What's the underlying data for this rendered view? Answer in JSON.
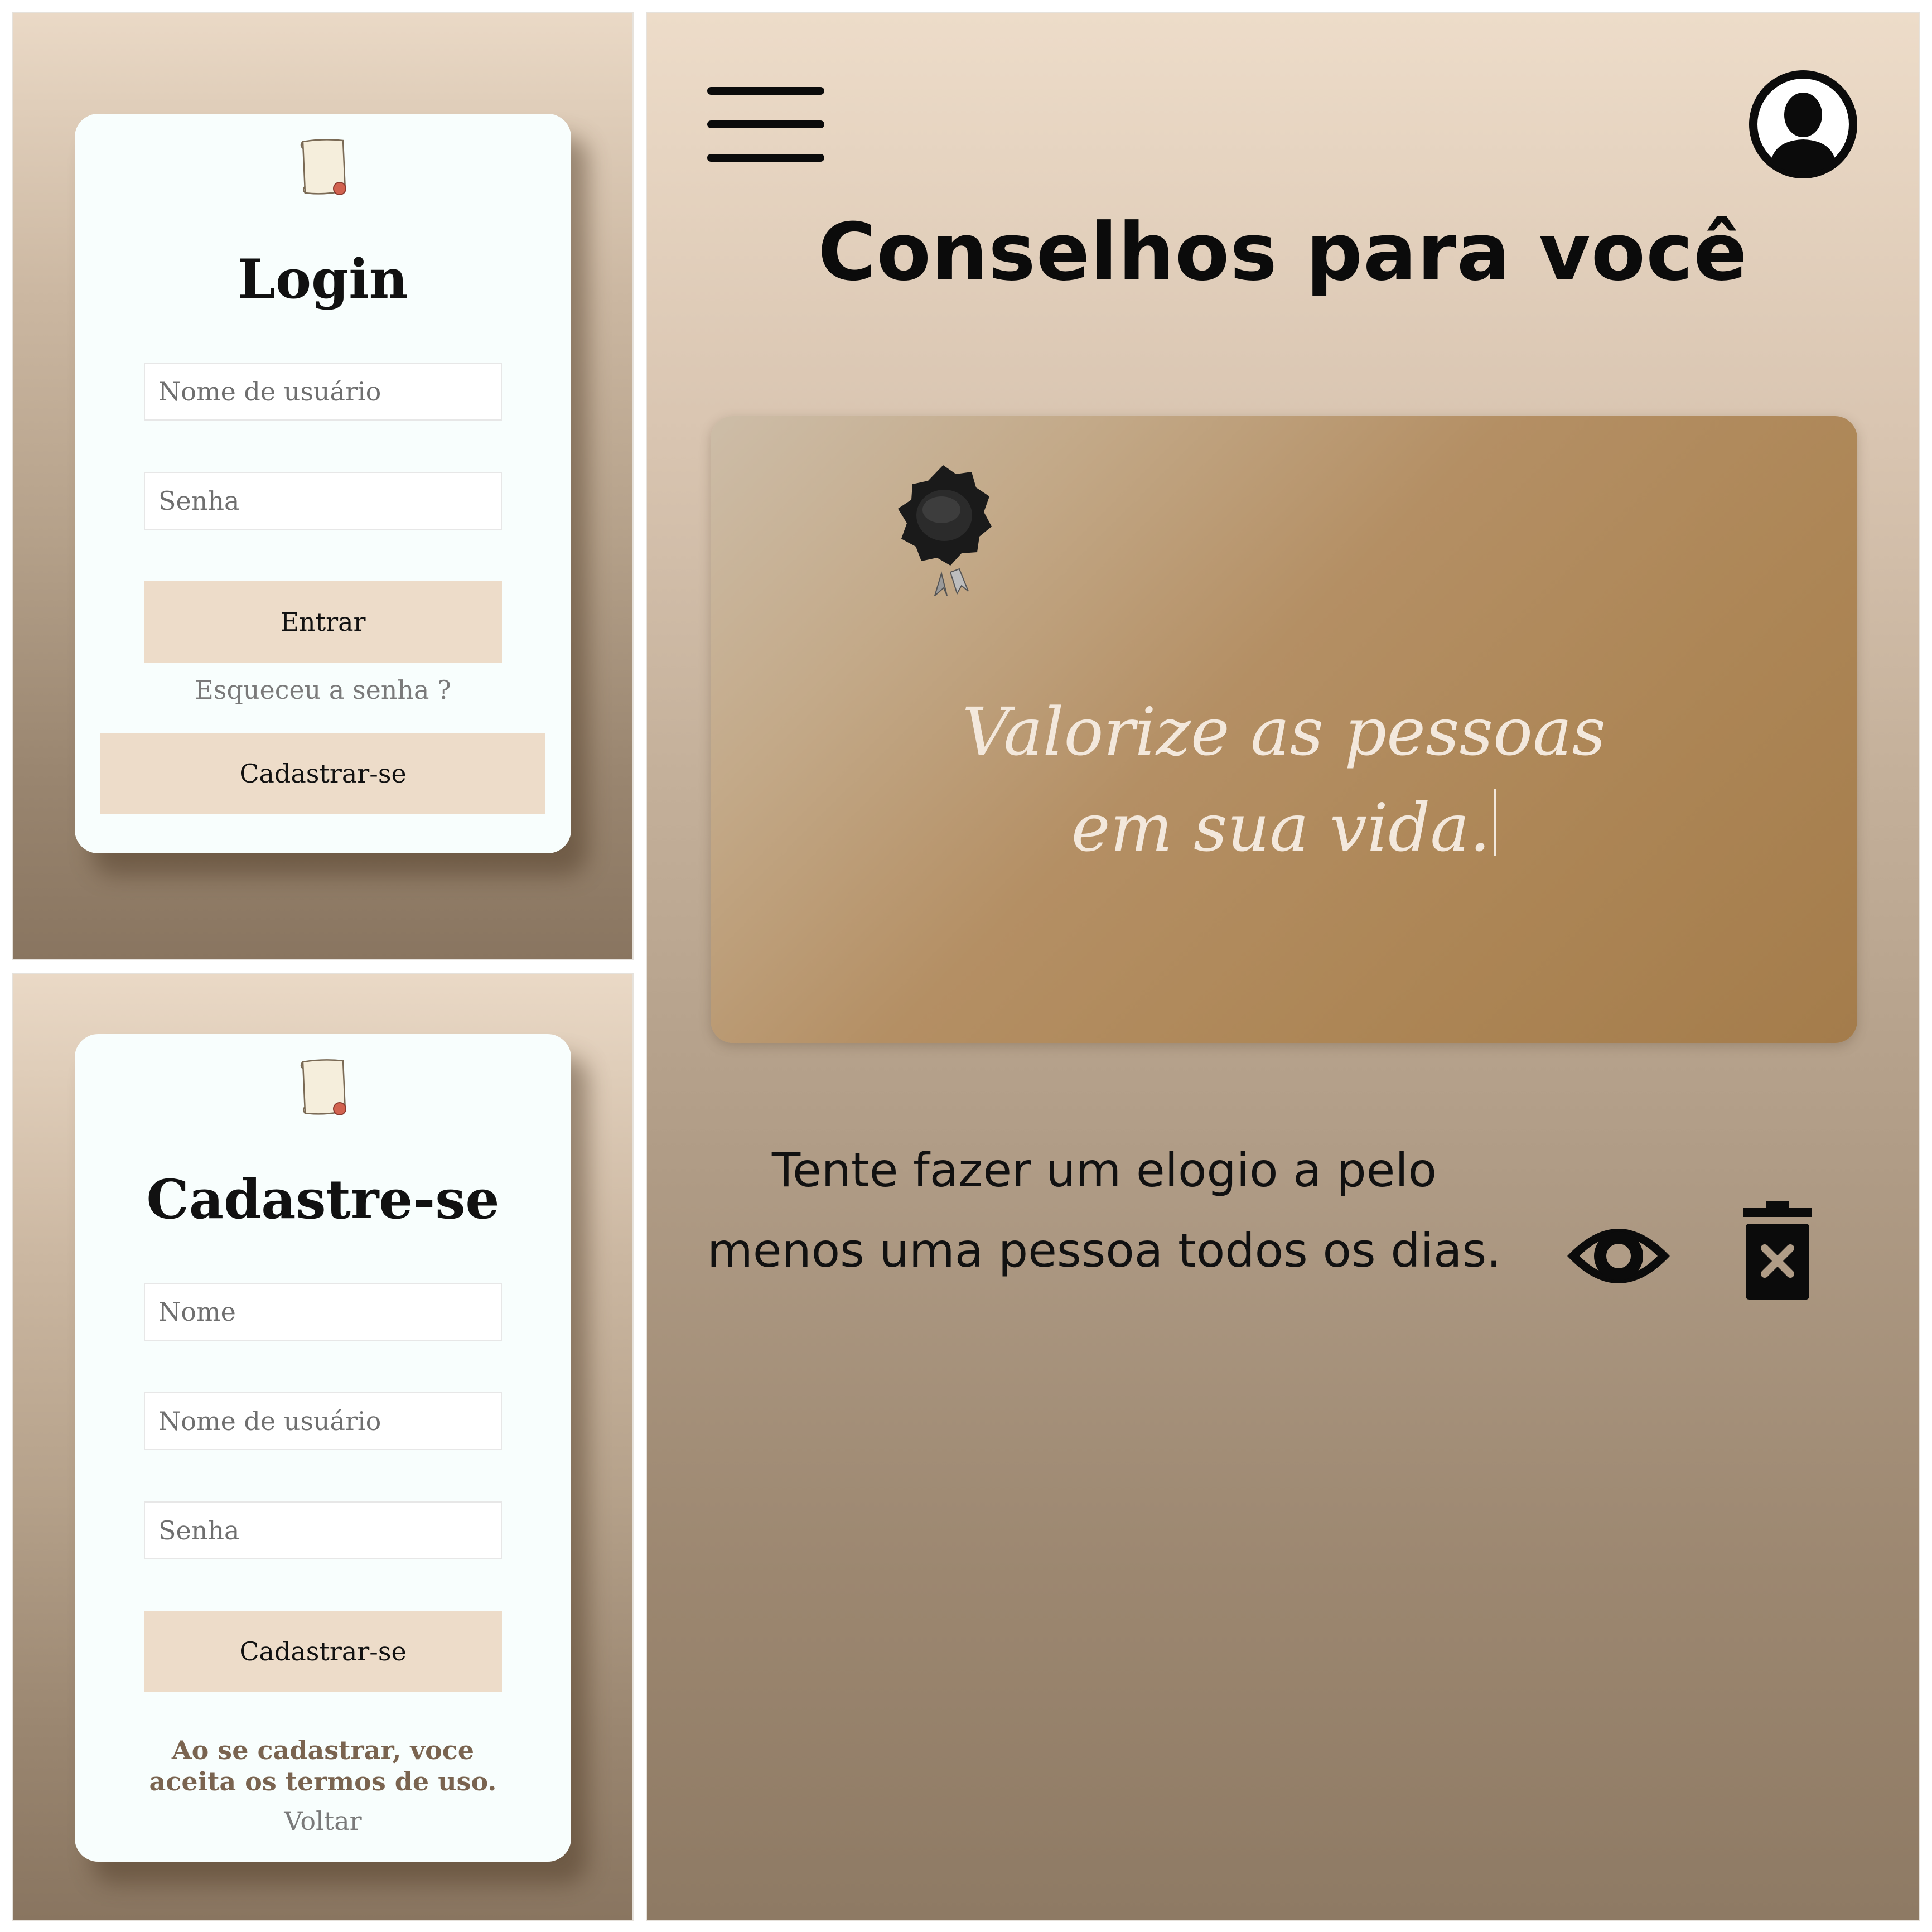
{
  "login": {
    "title": "Login",
    "username_placeholder": "Nome de usuário",
    "password_placeholder": "Senha",
    "submit_label": "Entrar",
    "forgot_label": "Esqueceu a senha ?",
    "register_label": "Cadastrar-se"
  },
  "signup": {
    "title": "Cadastre-se",
    "name_placeholder": "Nome",
    "username_placeholder": "Nome de usuário",
    "password_placeholder": "Senha",
    "submit_label": "Cadastrar-se",
    "terms_text": "Ao se cadastrar, voce aceita os termos de uso.",
    "back_label": "Voltar"
  },
  "main": {
    "title": "Conselhos para você",
    "quote_line1": "Valorize as pessoas",
    "quote_line2": "em sua vida.",
    "advice": "Tente fazer um elogio a pelo menos uma pessoa todos os dias."
  },
  "icons": {
    "menu": "hamburger-menu-icon",
    "profile": "user-avatar-icon",
    "logo": "scroll-logo-icon",
    "seal": "wax-seal-icon",
    "view": "eye-icon",
    "delete": "trash-icon"
  },
  "colors": {
    "button_bg": "#eddcc9",
    "card_bg": "#f8fefd",
    "quote_card": "#b48f64",
    "terms_text": "#7a6450"
  }
}
